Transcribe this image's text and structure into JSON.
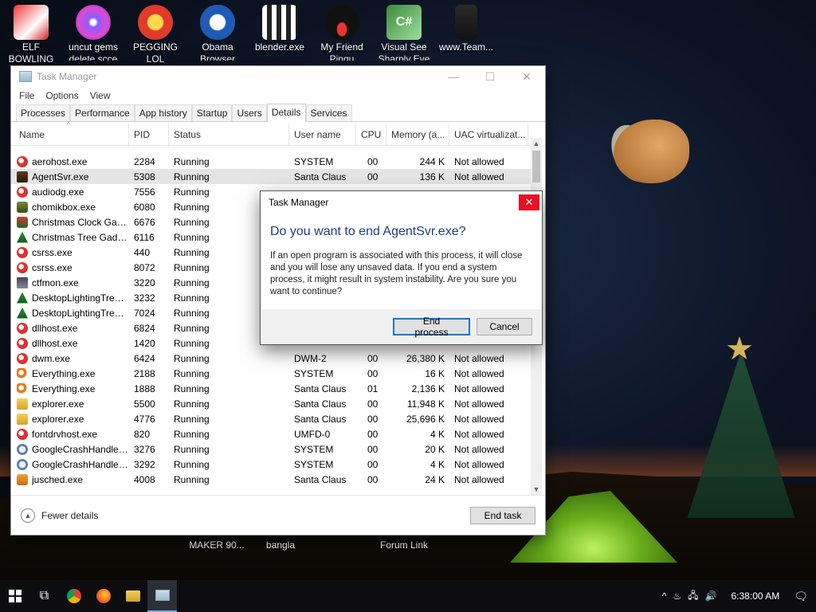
{
  "desktop": {
    "icons": [
      {
        "label": "ELF BOWLING",
        "line2": ""
      },
      {
        "label": "uncut gems",
        "line2": "delete scce"
      },
      {
        "label": "PEGGING LOL",
        "line2": ""
      },
      {
        "label": "Obama",
        "line2": "Browser"
      },
      {
        "label": "blender.exe",
        "line2": ""
      },
      {
        "label": "My Friend",
        "line2": "Pingu"
      },
      {
        "label": "Visual See",
        "line2": "Sharply Eve"
      },
      {
        "label": "www.Team...",
        "line2": ""
      }
    ],
    "bottom_labels": [
      "MAKER 90...",
      "bangla",
      "Forum Link"
    ]
  },
  "task_manager": {
    "title": "Task Manager",
    "menu": [
      "File",
      "Options",
      "View"
    ],
    "tabs": [
      "Processes",
      "Performance",
      "App history",
      "Startup",
      "Users",
      "Details",
      "Services"
    ],
    "active_tab": "Details",
    "columns": [
      "Name",
      "PID",
      "Status",
      "User name",
      "CPU",
      "Memory (a...",
      "UAC virtualizat..."
    ],
    "rows": [
      {
        "name": "aerohost.exe",
        "pid": "2284",
        "status": "Running",
        "user": "SYSTEM",
        "cpu": "00",
        "mem": "244 K",
        "uac": "Not allowed",
        "icon": "default"
      },
      {
        "name": "AgentSvr.exe",
        "pid": "5308",
        "status": "Running",
        "user": "Santa Claus",
        "cpu": "00",
        "mem": "136 K",
        "uac": "Not allowed",
        "icon": "agent",
        "selected": true
      },
      {
        "name": "audiodg.exe",
        "pid": "7556",
        "status": "Running",
        "user": "",
        "cpu": "",
        "mem": "",
        "uac": "",
        "icon": "default"
      },
      {
        "name": "chomikbox.exe",
        "pid": "6080",
        "status": "Running",
        "user": "",
        "cpu": "",
        "mem": "",
        "uac": "",
        "icon": "chomik"
      },
      {
        "name": "Christmas Clock Gad...",
        "pid": "6676",
        "status": "Running",
        "user": "",
        "cpu": "",
        "mem": "",
        "uac": "",
        "icon": "xmas"
      },
      {
        "name": "Christmas Tree Gadg...",
        "pid": "6116",
        "status": "Running",
        "user": "",
        "cpu": "",
        "mem": "",
        "uac": "",
        "icon": "tree"
      },
      {
        "name": "csrss.exe",
        "pid": "440",
        "status": "Running",
        "user": "",
        "cpu": "",
        "mem": "",
        "uac": "",
        "icon": "default"
      },
      {
        "name": "csrss.exe",
        "pid": "8072",
        "status": "Running",
        "user": "",
        "cpu": "",
        "mem": "",
        "uac": "",
        "icon": "default"
      },
      {
        "name": "ctfmon.exe",
        "pid": "3220",
        "status": "Running",
        "user": "",
        "cpu": "",
        "mem": "",
        "uac": "",
        "icon": "ctf"
      },
      {
        "name": "DesktopLightingTree....",
        "pid": "3232",
        "status": "Running",
        "user": "",
        "cpu": "",
        "mem": "",
        "uac": "",
        "icon": "tree"
      },
      {
        "name": "DesktopLightingTree....",
        "pid": "7024",
        "status": "Running",
        "user": "",
        "cpu": "",
        "mem": "",
        "uac": "",
        "icon": "tree"
      },
      {
        "name": "dllhost.exe",
        "pid": "6824",
        "status": "Running",
        "user": "",
        "cpu": "",
        "mem": "",
        "uac": "",
        "icon": "default"
      },
      {
        "name": "dllhost.exe",
        "pid": "1420",
        "status": "Running",
        "user": "",
        "cpu": "",
        "mem": "",
        "uac": "",
        "icon": "default"
      },
      {
        "name": "dwm.exe",
        "pid": "6424",
        "status": "Running",
        "user": "DWM-2",
        "cpu": "00",
        "mem": "26,380 K",
        "uac": "Not allowed",
        "icon": "default"
      },
      {
        "name": "Everything.exe",
        "pid": "2188",
        "status": "Running",
        "user": "SYSTEM",
        "cpu": "00",
        "mem": "16 K",
        "uac": "Not allowed",
        "icon": "search"
      },
      {
        "name": "Everything.exe",
        "pid": "1888",
        "status": "Running",
        "user": "Santa Claus",
        "cpu": "01",
        "mem": "2,136 K",
        "uac": "Not allowed",
        "icon": "search"
      },
      {
        "name": "explorer.exe",
        "pid": "5500",
        "status": "Running",
        "user": "Santa Claus",
        "cpu": "00",
        "mem": "11,948 K",
        "uac": "Not allowed",
        "icon": "folder"
      },
      {
        "name": "explorer.exe",
        "pid": "4776",
        "status": "Running",
        "user": "Santa Claus",
        "cpu": "00",
        "mem": "25,696 K",
        "uac": "Not allowed",
        "icon": "folder"
      },
      {
        "name": "fontdrvhost.exe",
        "pid": "820",
        "status": "Running",
        "user": "UMFD-0",
        "cpu": "00",
        "mem": "4 K",
        "uac": "Not allowed",
        "icon": "default"
      },
      {
        "name": "GoogleCrashHandler....",
        "pid": "3276",
        "status": "Running",
        "user": "SYSTEM",
        "cpu": "00",
        "mem": "20 K",
        "uac": "Not allowed",
        "icon": "google"
      },
      {
        "name": "GoogleCrashHandler....",
        "pid": "3292",
        "status": "Running",
        "user": "SYSTEM",
        "cpu": "00",
        "mem": "4 K",
        "uac": "Not allowed",
        "icon": "google"
      },
      {
        "name": "jusched.exe",
        "pid": "4008",
        "status": "Running",
        "user": "Santa Claus",
        "cpu": "00",
        "mem": "24 K",
        "uac": "Not allowed",
        "icon": "java"
      }
    ],
    "fewer_details": "Fewer details",
    "end_task": "End task"
  },
  "dialog": {
    "title": "Task Manager",
    "heading": "Do you want to end AgentSvr.exe?",
    "body": "If an open program is associated with this process, it will close and you will lose any unsaved data. If you end a system process, it might result in system instability. Are you sure you want to continue?",
    "confirm": "End process",
    "cancel": "Cancel"
  },
  "taskbar": {
    "clock": "6:38:00 AM"
  },
  "colors": {
    "accent": "#0078d7",
    "close_red": "#e81123",
    "dialog_heading": "#1e3b8a",
    "selected_row": "#e5e5e5"
  }
}
